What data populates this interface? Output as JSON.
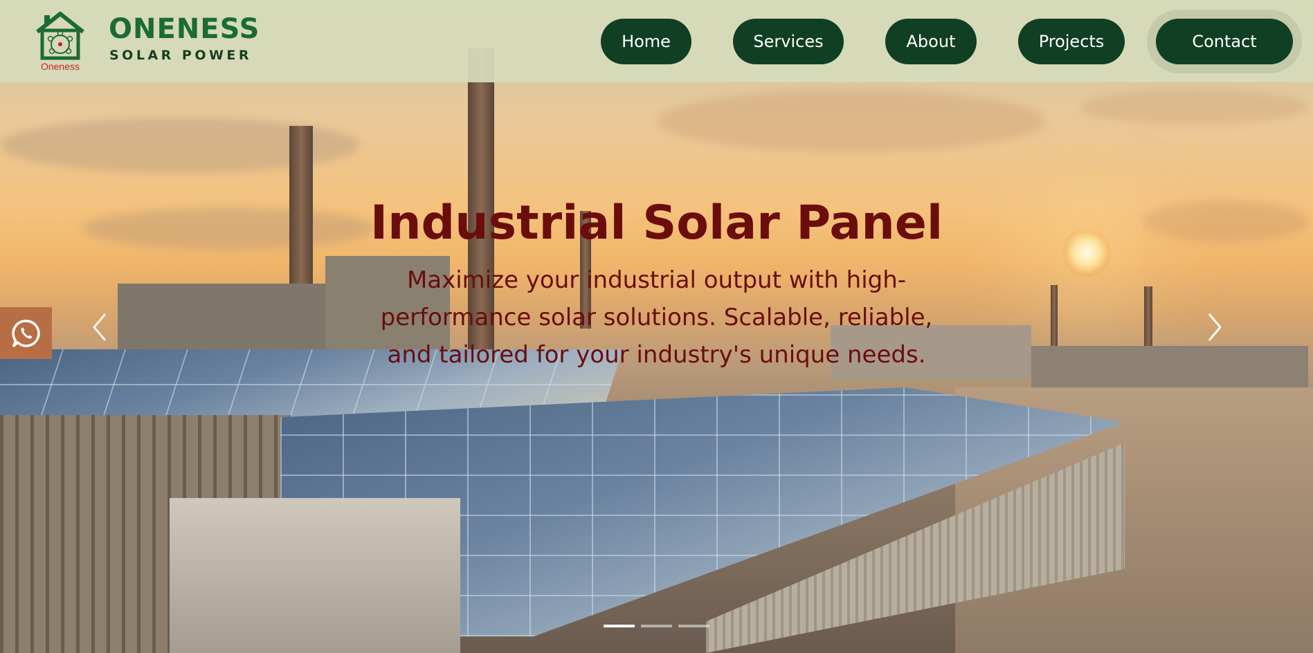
{
  "brand": {
    "logo_caption": "Oneness",
    "name": "ONENESS",
    "tagline": "SOLAR POWER"
  },
  "nav": {
    "items": [
      {
        "label": "Home"
      },
      {
        "label": "Services"
      },
      {
        "label": "About"
      },
      {
        "label": "Projects"
      },
      {
        "label": "Contact"
      }
    ]
  },
  "hero": {
    "title": "Industrial Solar Panel",
    "subtitle_lines": [
      "Maximize your industrial output with high-",
      "performance solar solutions. Scalable, reliable,",
      "and tailored for your industry's unique needs."
    ],
    "slides_total": 3,
    "active_slide": 1
  },
  "icons": {
    "logo": "house-solar-logo-icon",
    "prev": "chevron-left-icon",
    "next": "chevron-right-icon",
    "whatsapp": "whatsapp-icon"
  },
  "colors": {
    "header_bg": "#d6dbba",
    "brand_green": "#1b6b36",
    "nav_button_bg": "#113f24",
    "nav_button_text": "#ffffff",
    "hero_text": "#6b0d0d",
    "whatsapp_bg": "#b86e45",
    "logo_red": "#c0262b"
  }
}
